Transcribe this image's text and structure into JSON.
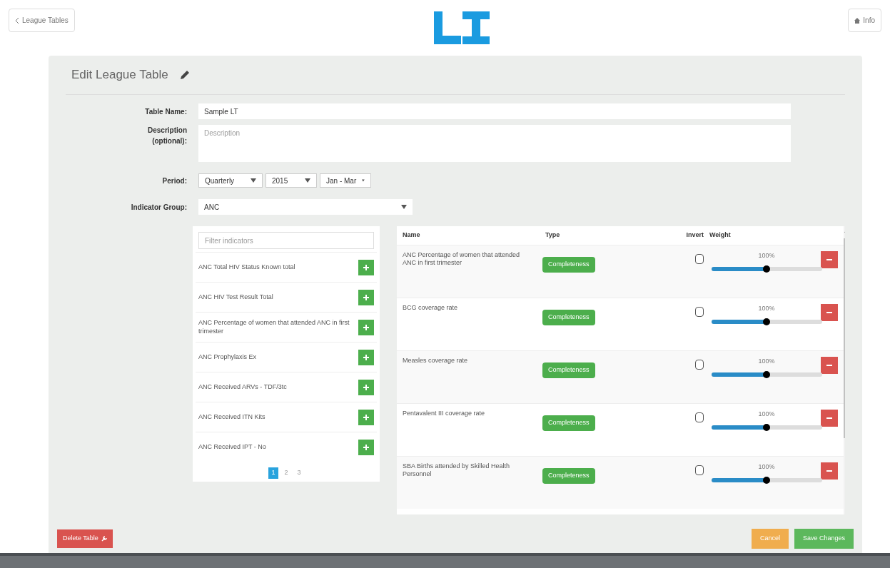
{
  "header": {
    "back_button": "League Tables",
    "menu_button": "Info"
  },
  "card": {
    "title": "Edit League Table"
  },
  "form": {
    "table_name": {
      "label": "Table Name:",
      "value": "Sample LT"
    },
    "description": {
      "label": "Description (optional):",
      "placeholder": "Description"
    },
    "period": {
      "label": "Period:",
      "selects": [
        "Quarterly",
        "2015",
        "Jan - Mar"
      ]
    },
    "indicator_group": {
      "label": "Indicator Group:",
      "value": "ANC"
    }
  },
  "indicator_list": {
    "filter_placeholder": "Filter indicators",
    "items": [
      "ANC Total HIV Status Known total",
      "ANC HIV Test Result Total",
      "ANC Percentage of women that attended ANC in first trimester",
      "ANC Prophylaxis Ex",
      "ANC Received ARVs - TDF/3tc",
      "ANC Received ITN Kits",
      "ANC Received IPT - No"
    ],
    "pages": [
      {
        "label": "1",
        "selected": true
      },
      {
        "label": "2",
        "selected": false
      },
      {
        "label": "3",
        "selected": false
      }
    ]
  },
  "table": {
    "columns": [
      "Name",
      "Type",
      "Invert",
      "Weight"
    ],
    "rows": [
      {
        "name": "ANC Percentage of women that attended ANC in first trimester",
        "type": "Completeness",
        "invert": false,
        "weight": "100%",
        "level": 0.5
      },
      {
        "name": "BCG coverage rate",
        "type": "Completeness",
        "invert": false,
        "weight": "100%",
        "level": 0.5
      },
      {
        "name": "Measles coverage rate",
        "type": "Completeness",
        "invert": false,
        "weight": "100%",
        "level": 0.5
      },
      {
        "name": "Pentavalent III coverage rate",
        "type": "Completeness",
        "invert": false,
        "weight": "100%",
        "level": 0.5
      },
      {
        "name": "SBA Births attended by Skilled Health Personnel",
        "type": "Completeness",
        "invert": false,
        "weight": "100%",
        "level": 0.5
      }
    ]
  },
  "footer": {
    "delete_button": "Delete Table",
    "cancel_button": "Cancel",
    "save_button": "Save Changes"
  }
}
